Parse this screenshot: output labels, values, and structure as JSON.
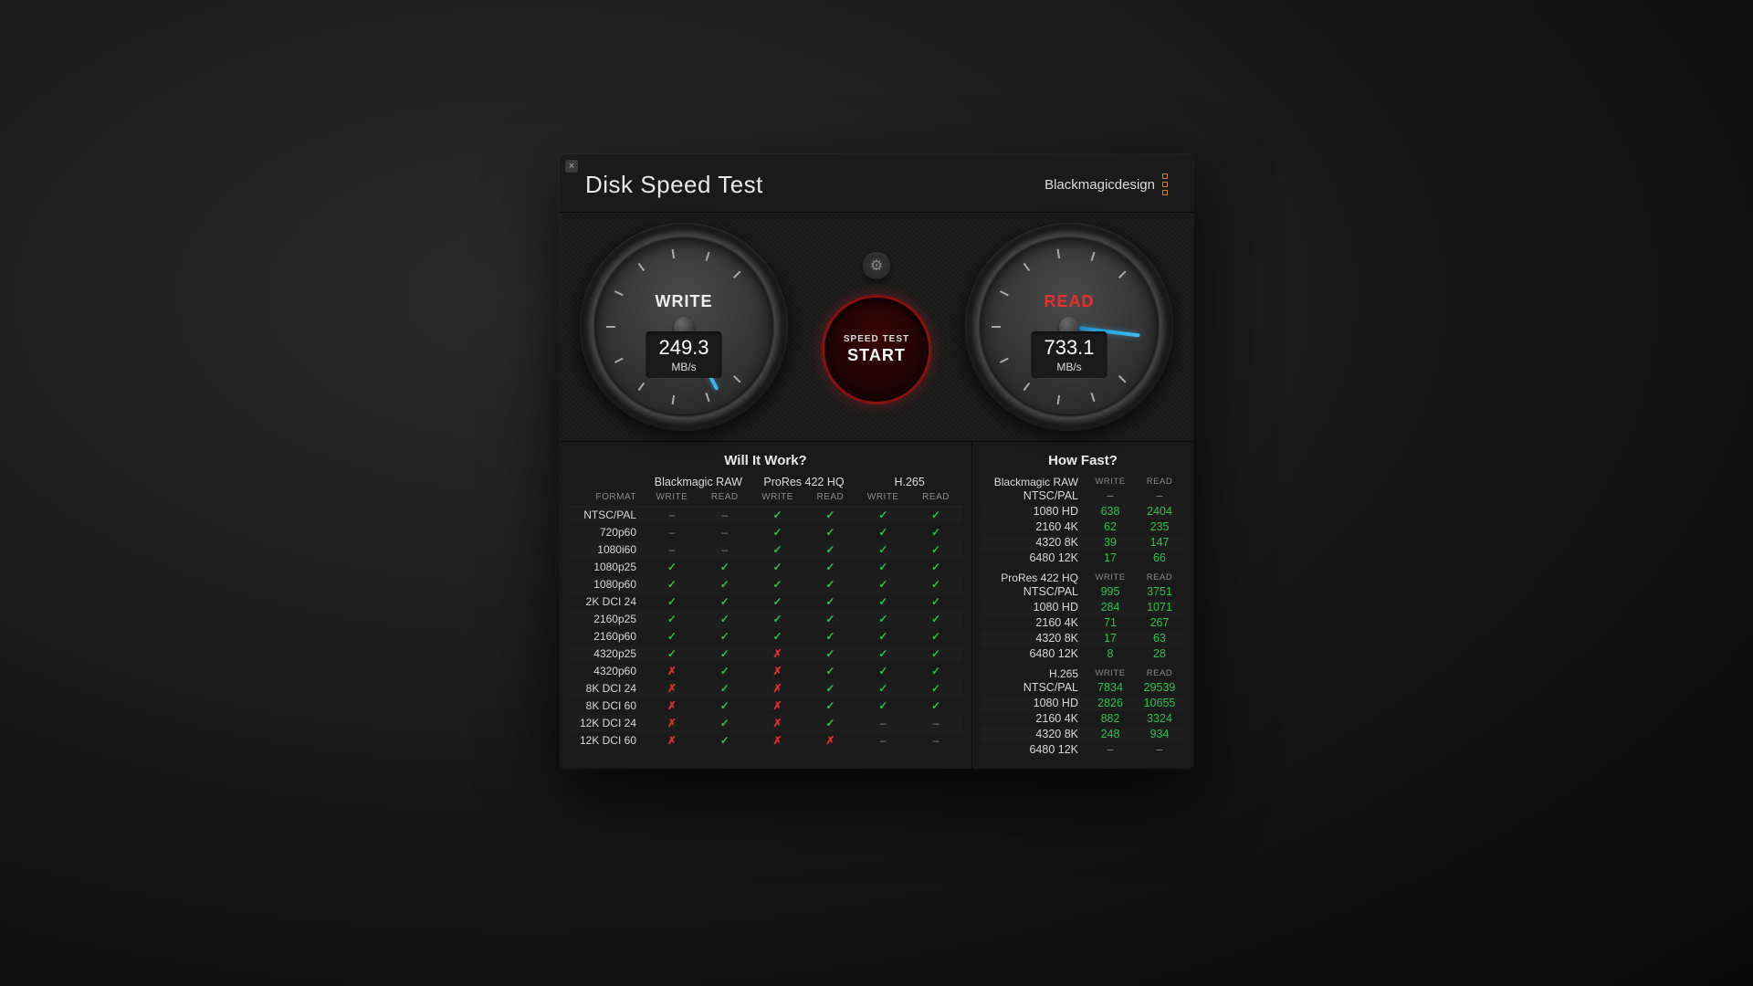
{
  "header": {
    "title": "Disk Speed Test",
    "brand": "Blackmagicdesign"
  },
  "gauges": {
    "write": {
      "label": "WRITE",
      "value": "249.3",
      "unit": "MB/s",
      "angle": 118
    },
    "read": {
      "label": "READ",
      "value": "733.1",
      "unit": "MB/s",
      "angle": 173
    },
    "start": {
      "line1": "SPEED TEST",
      "line2": "START"
    }
  },
  "will_it_work": {
    "title": "Will It Work?",
    "codecs": [
      "Blackmagic RAW",
      "ProRes 422 HQ",
      "H.265"
    ],
    "sub": [
      "FORMAT",
      "WRITE",
      "READ",
      "WRITE",
      "READ",
      "WRITE",
      "READ"
    ],
    "rows": [
      {
        "fmt": "NTSC/PAL",
        "cells": [
          "-",
          "-",
          "y",
          "y",
          "y",
          "y"
        ]
      },
      {
        "fmt": "720p60",
        "cells": [
          "-",
          "-",
          "y",
          "y",
          "y",
          "y"
        ]
      },
      {
        "fmt": "1080i60",
        "cells": [
          "-",
          "-",
          "y",
          "y",
          "y",
          "y"
        ]
      },
      {
        "fmt": "1080p25",
        "cells": [
          "y",
          "y",
          "y",
          "y",
          "y",
          "y"
        ]
      },
      {
        "fmt": "1080p60",
        "cells": [
          "y",
          "y",
          "y",
          "y",
          "y",
          "y"
        ]
      },
      {
        "fmt": "2K DCI 24",
        "cells": [
          "y",
          "y",
          "y",
          "y",
          "y",
          "y"
        ]
      },
      {
        "fmt": "2160p25",
        "cells": [
          "y",
          "y",
          "y",
          "y",
          "y",
          "y"
        ]
      },
      {
        "fmt": "2160p60",
        "cells": [
          "y",
          "y",
          "y",
          "y",
          "y",
          "y"
        ]
      },
      {
        "fmt": "4320p25",
        "cells": [
          "y",
          "y",
          "n",
          "y",
          "y",
          "y"
        ]
      },
      {
        "fmt": "4320p60",
        "cells": [
          "n",
          "y",
          "n",
          "y",
          "y",
          "y"
        ]
      },
      {
        "fmt": "8K DCI 24",
        "cells": [
          "n",
          "y",
          "n",
          "y",
          "y",
          "y"
        ]
      },
      {
        "fmt": "8K DCI 60",
        "cells": [
          "n",
          "y",
          "n",
          "y",
          "y",
          "y"
        ]
      },
      {
        "fmt": "12K DCI 24",
        "cells": [
          "n",
          "y",
          "n",
          "y",
          "-",
          "-"
        ]
      },
      {
        "fmt": "12K DCI 60",
        "cells": [
          "n",
          "y",
          "n",
          "n",
          "-",
          "-"
        ]
      }
    ]
  },
  "how_fast": {
    "title": "How Fast?",
    "sections": [
      {
        "codec": "Blackmagic RAW",
        "rows": [
          {
            "label": "NTSC/PAL",
            "write": "-",
            "read": "-"
          },
          {
            "label": "1080 HD",
            "write": "638",
            "read": "2404"
          },
          {
            "label": "2160 4K",
            "write": "62",
            "read": "235"
          },
          {
            "label": "4320 8K",
            "write": "39",
            "read": "147"
          },
          {
            "label": "6480 12K",
            "write": "17",
            "read": "66"
          }
        ]
      },
      {
        "codec": "ProRes 422 HQ",
        "rows": [
          {
            "label": "NTSC/PAL",
            "write": "995",
            "read": "3751"
          },
          {
            "label": "1080 HD",
            "write": "284",
            "read": "1071"
          },
          {
            "label": "2160 4K",
            "write": "71",
            "read": "267"
          },
          {
            "label": "4320 8K",
            "write": "17",
            "read": "63"
          },
          {
            "label": "6480 12K",
            "write": "8",
            "read": "28"
          }
        ]
      },
      {
        "codec": "H.265",
        "rows": [
          {
            "label": "NTSC/PAL",
            "write": "7834",
            "read": "29539"
          },
          {
            "label": "1080 HD",
            "write": "2826",
            "read": "10655"
          },
          {
            "label": "2160 4K",
            "write": "882",
            "read": "3324"
          },
          {
            "label": "4320 8K",
            "write": "248",
            "read": "934"
          },
          {
            "label": "6480 12K",
            "write": "-",
            "read": "-"
          }
        ]
      }
    ]
  }
}
